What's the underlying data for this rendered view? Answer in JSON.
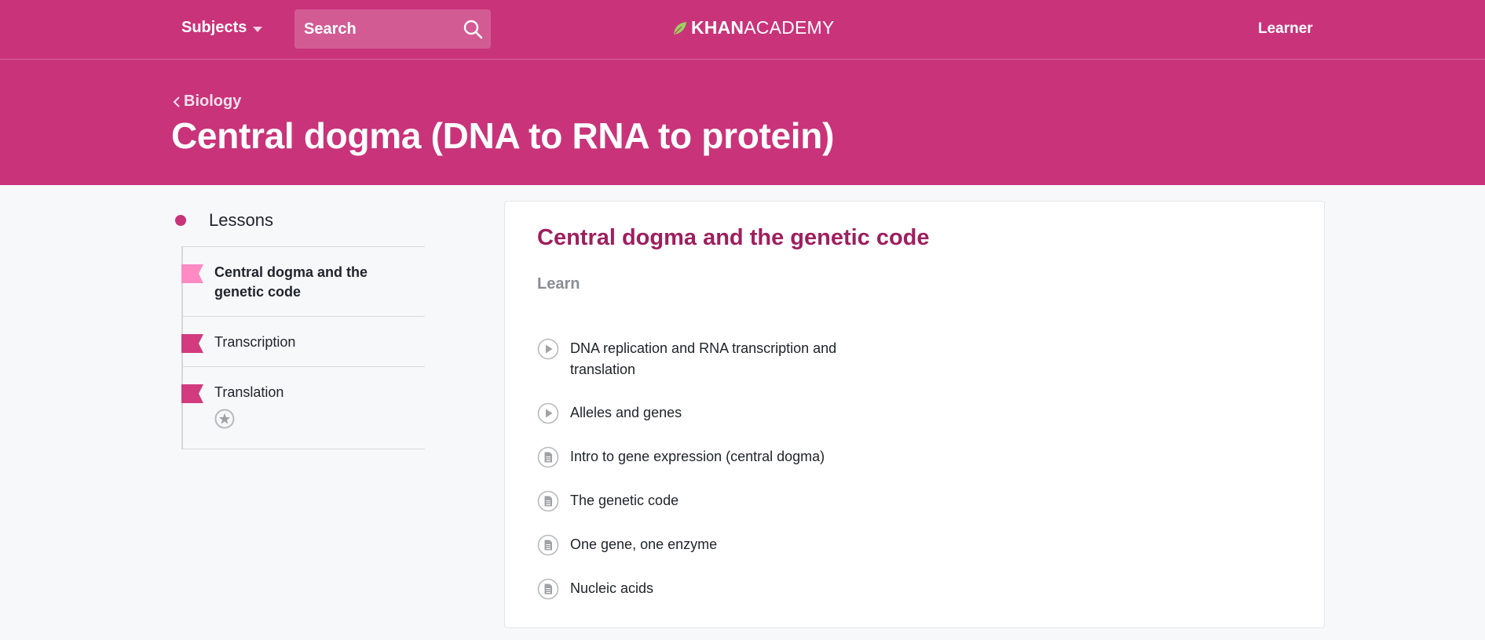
{
  "header": {
    "subjects_label": "Subjects",
    "search_placeholder": "Search",
    "logo_bold": "KHAN",
    "logo_light": "ACADEMY",
    "user_label": "Learner"
  },
  "hero": {
    "breadcrumb": "Biology",
    "title": "Central dogma (DNA to RNA to protein)"
  },
  "sidebar": {
    "heading": "Lessons",
    "items": [
      {
        "label": "Central dogma and the genetic code",
        "active": true
      },
      {
        "label": "Transcription",
        "active": false
      },
      {
        "label": "Translation",
        "active": false
      }
    ]
  },
  "lesson": {
    "title": "Central dogma and the genetic code",
    "section_label": "Learn",
    "items": [
      {
        "label": "DNA replication and RNA transcription and translation",
        "icon": "play-icon"
      },
      {
        "label": "Alleles and genes",
        "icon": "play-icon"
      },
      {
        "label": "Intro to gene expression (central dogma)",
        "icon": "article-icon"
      },
      {
        "label": "The genetic code",
        "icon": "article-icon"
      },
      {
        "label": "One gene, one enzyme",
        "icon": "article-icon"
      },
      {
        "label": "Nucleic acids",
        "icon": "article-icon"
      }
    ]
  },
  "colors": {
    "brand": "#c9337a",
    "title_accent": "#9e1f5e",
    "flag_active": "#ff8ac4",
    "flag_default": "#d23b7e"
  }
}
